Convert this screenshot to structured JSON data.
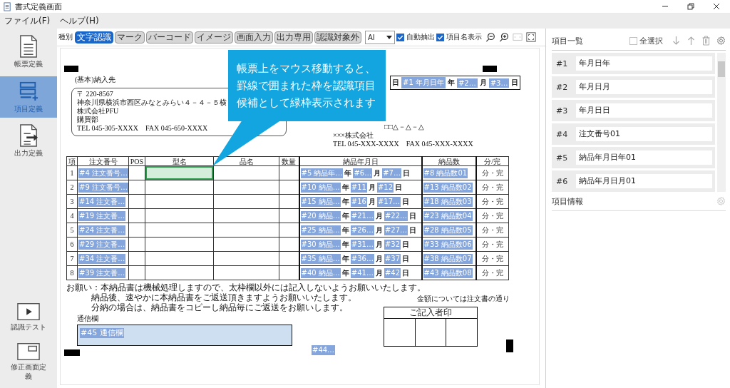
{
  "window": {
    "title": "書式定義画面"
  },
  "menu": [
    "ファイル(F)",
    "ヘルプ(H)"
  ],
  "sidebar": {
    "items": [
      {
        "label": "帳票定義",
        "kind": "document",
        "selected": false
      },
      {
        "label": "項目定義",
        "kind": "item-add",
        "selected": true
      },
      {
        "label": "出力定義",
        "kind": "export",
        "selected": false
      }
    ],
    "bottom_items": [
      {
        "label": "認識テスト",
        "kind": "play",
        "selected": false
      },
      {
        "label": "修正画面定義",
        "kind": "window",
        "selected": false
      }
    ]
  },
  "toolbar": {
    "type_label": "種別",
    "types": [
      {
        "label": "文字認識",
        "selected": true
      },
      {
        "label": "マーク",
        "selected": false
      },
      {
        "label": "バーコード",
        "selected": false
      },
      {
        "label": "イメージ",
        "selected": false
      },
      {
        "label": "画面入力",
        "selected": false
      },
      {
        "label": "出力専用",
        "selected": false
      },
      {
        "label": "認識対象外",
        "selected": false
      }
    ],
    "engine": "AI",
    "checks": [
      {
        "label": "自動抽出",
        "checked": true
      },
      {
        "label": "項目名表示",
        "checked": true
      }
    ]
  },
  "callout": {
    "text": "帳票上をマウス移動すると、罫線で囲まれた枠を認識項目候補として緑枠表示されます"
  },
  "form": {
    "recipient_label": "(基本)納入先",
    "address_lines": [
      "〒 220-8567",
      "神奈川県横浜市西区みなとみらい４－４－５横",
      "株式会社PFU",
      "購買部",
      "TEL 045-305-XXXX　FAX 045-650-XXXX"
    ],
    "date_prefix": "日",
    "date_fields": [
      {
        "tag": "#1 年月日年",
        "unit": "年"
      },
      {
        "tag": "#2…",
        "unit": "月"
      },
      {
        "tag": "#3…",
        "unit": "日"
      }
    ],
    "sender_lines": [
      "□□△－△－△",
      "×××株式会社",
      "TEL 045-XXX-XXXX　FAX 045-XXX-XXXX"
    ],
    "table": {
      "columns": [
        "項",
        "注文番号",
        "POS",
        "型名",
        "品名",
        "数量",
        "納品年月日",
        "納品数",
        "分/完"
      ],
      "rows": [
        {
          "no": "1",
          "order": "#4 注文番号…",
          "model_hovered": true,
          "date": [
            {
              "tag": "#5 納品年…",
              "unit": "年"
            },
            {
              "tag": "#6…",
              "unit": "月"
            },
            {
              "tag": "#7…",
              "unit": "日"
            }
          ],
          "qty": "#8 納品数01",
          "status": "分・完"
        },
        {
          "no": "2",
          "order": "#9 注文番号…",
          "model_hovered": false,
          "date": [
            {
              "tag": "#10 納品…",
              "unit": "年"
            },
            {
              "tag": "#11",
              "unit": "月"
            },
            {
              "tag": "#12",
              "unit": "日"
            }
          ],
          "qty": "#13 納品数02",
          "status": "分・完"
        },
        {
          "no": "3",
          "order": "#14 注文番…",
          "model_hovered": false,
          "date": [
            {
              "tag": "#15 納品…",
              "unit": "年"
            },
            {
              "tag": "#16",
              "unit": "月"
            },
            {
              "tag": "#17…",
              "unit": "日"
            }
          ],
          "qty": "#18 納品数03",
          "status": "分・完"
        },
        {
          "no": "4",
          "order": "#19 注文番…",
          "model_hovered": false,
          "date": [
            {
              "tag": "#20 納品…",
              "unit": "年"
            },
            {
              "tag": "#21…",
              "unit": "月"
            },
            {
              "tag": "#22…",
              "unit": "日"
            }
          ],
          "qty": "#23 納品数04",
          "status": "分・完"
        },
        {
          "no": "5",
          "order": "#24 注文番…",
          "model_hovered": false,
          "date": [
            {
              "tag": "#25 納品…",
              "unit": "年"
            },
            {
              "tag": "#26…",
              "unit": "月"
            },
            {
              "tag": "#27…",
              "unit": "日"
            }
          ],
          "qty": "#28 納品数05",
          "status": "分・完"
        },
        {
          "no": "6",
          "order": "#29 注文番…",
          "model_hovered": false,
          "date": [
            {
              "tag": "#30 納品…",
              "unit": "年"
            },
            {
              "tag": "#31…",
              "unit": "月"
            },
            {
              "tag": "#32",
              "unit": "日"
            }
          ],
          "qty": "#33 納品数06",
          "status": "分・完"
        },
        {
          "no": "7",
          "order": "#34 注文番…",
          "model_hovered": false,
          "date": [
            {
              "tag": "#35 納品…",
              "unit": "年"
            },
            {
              "tag": "#36…",
              "unit": "月"
            },
            {
              "tag": "#37",
              "unit": "日"
            }
          ],
          "qty": "#38 納品数07",
          "status": "分・完"
        },
        {
          "no": "8",
          "order": "#39 注文番…",
          "model_hovered": false,
          "date": [
            {
              "tag": "#40 納品…",
              "unit": "年"
            },
            {
              "tag": "#41…",
              "unit": "月"
            },
            {
              "tag": "#42",
              "unit": "日"
            }
          ],
          "qty": "#43 納品数08",
          "status": "分・完"
        }
      ]
    },
    "notes": [
      "お願い：本納品書は機械処理しますので、太枠欄以外には記入しないようお願いいたします。",
      "納品後、速やかに本納品書をご返送頂きますようお願いいたします。",
      "分納の場合は、納品書をコピーし納品毎にご返送をお願いします。"
    ],
    "amount_note": "金額については注文書の通り",
    "stamp_label": "ご記入者印",
    "memo_label": "通信欄",
    "memo_tag": "#45 通信欄",
    "loose_tag": "#44…"
  },
  "item_list": {
    "title": "項目一覧",
    "select_all": {
      "label": "全選択",
      "checked": false
    },
    "items": [
      {
        "no": "#1",
        "name": "年月日年"
      },
      {
        "no": "#2",
        "name": "年月日月"
      },
      {
        "no": "#3",
        "name": "年月日日"
      },
      {
        "no": "#4",
        "name": "注文番号01"
      },
      {
        "no": "#5",
        "name": "納品年月日年01"
      },
      {
        "no": "#6",
        "name": "納品年月日月01"
      }
    ]
  },
  "item_info": {
    "title": "項目情報"
  }
}
